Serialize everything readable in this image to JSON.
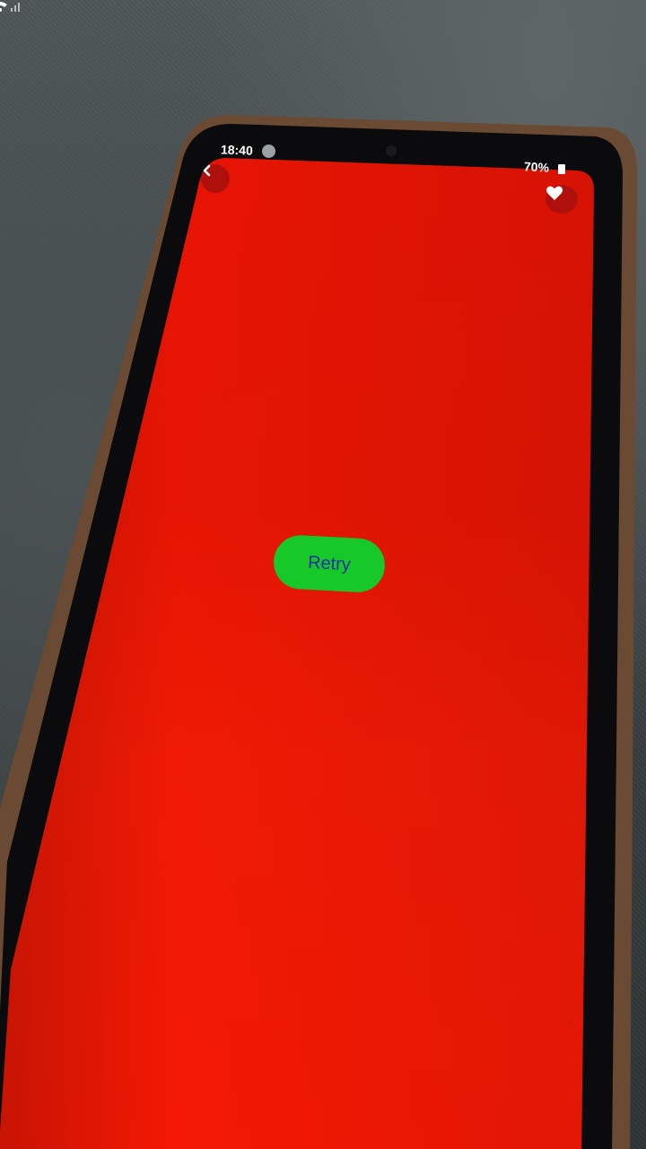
{
  "status_bar": {
    "time": "18:40",
    "battery": "70%"
  },
  "header": {
    "back_icon": "chevron-left-icon",
    "favorite_icon": "heart-icon"
  },
  "main": {
    "retry_label": "Retry"
  },
  "colors": {
    "screen_background": "#f01a08",
    "retry_button_background": "#17c829",
    "retry_button_text": "#1f2ea8",
    "header_button_background": "#b0100c"
  }
}
